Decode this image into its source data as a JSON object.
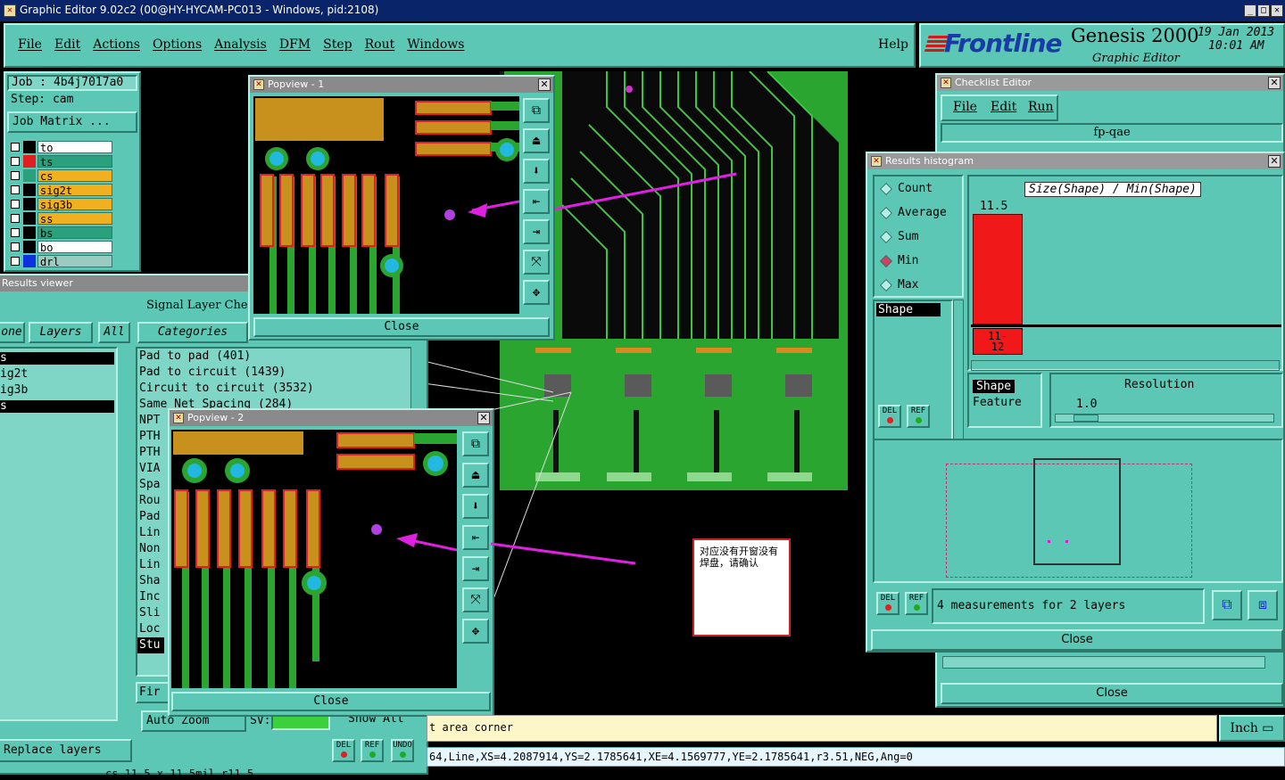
{
  "window": {
    "title": "Graphic Editor 9.02c2 (00@HY-HYCAM-PC013 - Windows, pid:2108)"
  },
  "menubar": {
    "items": [
      "File",
      "Edit",
      "Actions",
      "Options",
      "Analysis",
      "DFM",
      "Step",
      "Rout",
      "Windows"
    ],
    "help": "Help"
  },
  "brand": {
    "logo": "Frontline",
    "product": "Genesis 2000",
    "subtitle": "Graphic Editor",
    "date": "19  Jan 2013",
    "time": "10:01  AM"
  },
  "job": {
    "job_label": "Job : 4b4j7017a0",
    "step_label": "Step: cam",
    "matrix_button": "Job Matrix ..."
  },
  "layers": [
    {
      "name": "to",
      "color": "#ffffff",
      "swatch": "#000000"
    },
    {
      "name": "ts",
      "color": "#2aa17c",
      "swatch": "#e02020"
    },
    {
      "name": "cs",
      "color": "#f0b020",
      "swatch": "#2aa17c"
    },
    {
      "name": "sig2t",
      "color": "#f0b020",
      "swatch": "#000000"
    },
    {
      "name": "sig3b",
      "color": "#f0b020",
      "swatch": "#000000"
    },
    {
      "name": "ss",
      "color": "#f0b020",
      "swatch": "#000000"
    },
    {
      "name": "bs",
      "color": "#2aa17c",
      "swatch": "#000000"
    },
    {
      "name": "bo",
      "color": "#ffffff",
      "swatch": "#000000"
    },
    {
      "name": "drl",
      "color": "#9acac0",
      "swatch": "#1030e0"
    }
  ],
  "results_viewer": {
    "title": "Results viewer",
    "header": "Signal Layer Chec",
    "tabs": [
      "one",
      "Layers",
      "All",
      "Categories"
    ],
    "layer_list": [
      "s",
      "ig2t",
      "ig3b",
      "s"
    ],
    "categories": [
      "Pad to pad (401)",
      "Pad to circuit (1439)",
      "Circuit to circuit (3532)",
      "Same Net Spacing (284)",
      "NPT",
      "PTH",
      "PTH",
      "VIA",
      "Spa",
      "Rou",
      "Pad",
      "Lin",
      "Non",
      "Lin",
      "Sha",
      "Inc",
      "Sli",
      "Loc",
      "Stu"
    ],
    "find": "Fir",
    "zoom": "Auto Zoom",
    "sv": "SV:",
    "show_all": "Show All",
    "replace": "Replace layers",
    "del": "DEL",
    "ref": "REF",
    "undo": "UNDO",
    "status": "cs  11.5 x 11.5mil  r11.5"
  },
  "popview1": {
    "title": "Popview - 1",
    "close": "Close"
  },
  "popview2": {
    "title": "Popview - 2",
    "close": "Close"
  },
  "note": {
    "text": "对应没有开窗没有焊盘，请确认"
  },
  "checklist": {
    "title": "Checklist Editor",
    "menu": [
      "File",
      "Edit",
      "Run"
    ],
    "name": "fp-qae",
    "close": "Close"
  },
  "histogram": {
    "title": "Results histogram",
    "modes": [
      "Count",
      "Average",
      "Sum",
      "Min",
      "Max"
    ],
    "selected_mode": "Min",
    "axis_title": "Size(Shape) / Min(Shape)",
    "bar_value": "11.5",
    "bar_label": "11-\n12",
    "list_item": "Shape",
    "shape_options": [
      "Shape",
      "Feature"
    ],
    "resolution_label": "Resolution",
    "resolution_value": "1.0",
    "measurements": "4 measurements for 2 layers",
    "close": "Close",
    "del": "DEL",
    "ref": "REF"
  },
  "bottom": {
    "prompt": "t area corner",
    "unit": "Inch",
    "coords": "64,Line,XS=4.2087914,YS=2.1785641,XE=4.1569777,YE=2.1785641,r3.51,NEG,Ang=0"
  }
}
